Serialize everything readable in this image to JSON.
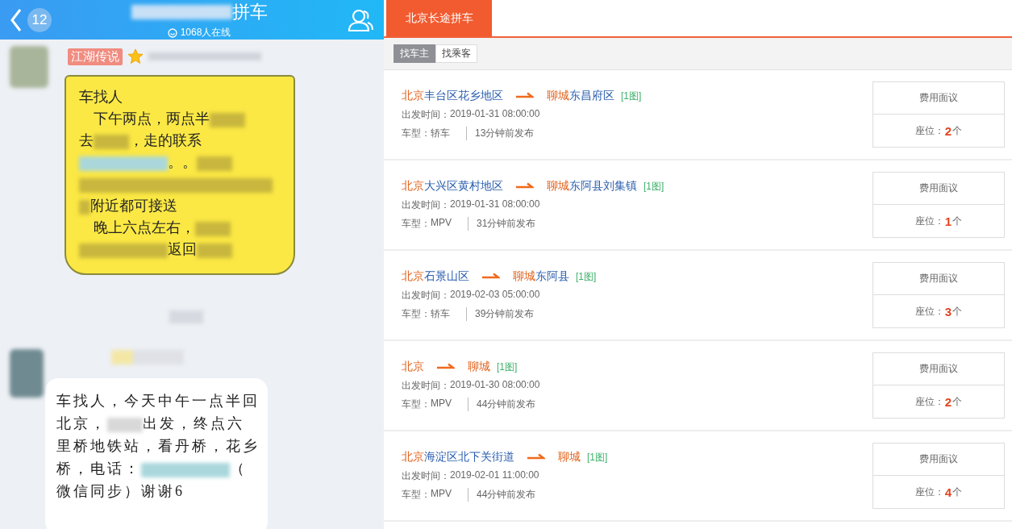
{
  "chat": {
    "header": {
      "back_count": "12",
      "title_redacted": true,
      "title": "拼车",
      "online": "1068人在线"
    },
    "messages": [
      {
        "kind": "sticker",
        "sender_tag": "江湖传说",
        "starred": true,
        "lines": [
          [
            {
              "text": "车找人"
            }
          ],
          [
            {
              "text": "　下午两点，两点半"
            },
            {
              "kind": "short"
            }
          ],
          [
            {
              "text": "去"
            },
            {
              "kind": "short"
            },
            {
              "text": "，走的联系"
            }
          ],
          [
            {
              "kind": "phone"
            },
            {
              "text": "。。"
            },
            {
              "kind": "short"
            }
          ],
          [
            {
              "kind": "full"
            }
          ],
          [
            {
              "kind": "tiny"
            },
            {
              "text": "附近都可接送"
            }
          ],
          [
            {
              "text": "　晚上六点左右，"
            },
            {
              "kind": "short"
            }
          ],
          [
            {
              "kind": "long"
            },
            {
              "text": "返回"
            },
            {
              "kind": "short"
            }
          ]
        ]
      },
      {
        "kind": "time"
      },
      {
        "kind": "message",
        "starred": false,
        "lines": [
          [
            {
              "text": "车找人，今天中午一点半回"
            }
          ],
          [
            {
              "text": "北京，"
            },
            {
              "kind": "short"
            },
            {
              "text": "出发，终点六"
            }
          ],
          [
            {
              "text": "里桥地铁站，看丹桥，花乡"
            }
          ],
          [
            {
              "text": "桥，电话："
            },
            {
              "kind": "phone"
            },
            {
              "text": "（"
            }
          ],
          [
            {
              "text": "微信同步）谢谢6"
            }
          ]
        ]
      }
    ]
  },
  "board": {
    "tab": "北京长途拼车",
    "filters": [
      {
        "label": "找车主",
        "selected": true
      },
      {
        "label": "找乘客",
        "selected": false
      }
    ],
    "rides": [
      {
        "from_city": "北京",
        "from_area": "丰台区花乡地区",
        "to_city": "聊城",
        "to_area": "东昌府区",
        "images": "[1图]",
        "depart_label": "出发时间：",
        "depart": "2019-01-31 08:00:00",
        "car_label": "车型：",
        "car": "轿车",
        "posted": "13分钟前发布",
        "fee": "费用面议",
        "seats_label": "座位：",
        "seats": "2",
        "seats_unit": "个"
      },
      {
        "from_city": "北京",
        "from_area": "大兴区黄村地区",
        "to_city": "聊城",
        "to_area": "东阿县刘集镇",
        "images": "[1图]",
        "depart_label": "出发时间：",
        "depart": "2019-01-31 08:00:00",
        "car_label": "车型：",
        "car": "MPV",
        "posted": "31分钟前发布",
        "fee": "费用面议",
        "seats_label": "座位：",
        "seats": "1",
        "seats_unit": "个"
      },
      {
        "from_city": "北京",
        "from_area": "石景山区",
        "to_city": "聊城",
        "to_area": "东阿县",
        "images": "[1图]",
        "depart_label": "出发时间：",
        "depart": "2019-02-03 05:00:00",
        "car_label": "车型：",
        "car": "轿车",
        "posted": "39分钟前发布",
        "fee": "费用面议",
        "seats_label": "座位：",
        "seats": "3",
        "seats_unit": "个"
      },
      {
        "from_city": "北京",
        "to_city": "聊城",
        "images": "[1图]",
        "depart_label": "出发时间：",
        "depart": "2019-01-30 08:00:00",
        "car_label": "车型：",
        "car": "MPV",
        "posted": "44分钟前发布",
        "fee": "费用面议",
        "seats_label": "座位：",
        "seats": "2",
        "seats_unit": "个"
      },
      {
        "from_city": "北京",
        "from_area": "海淀区北下关街道",
        "to_city": "聊城",
        "images": "[1图]",
        "depart_label": "出发时间：",
        "depart": "2019-02-01 11:00:00",
        "car_label": "车型：",
        "car": "MPV",
        "posted": "44分钟前发布",
        "fee": "费用面议",
        "seats_label": "座位：",
        "seats": "4",
        "seats_unit": "个"
      }
    ]
  }
}
